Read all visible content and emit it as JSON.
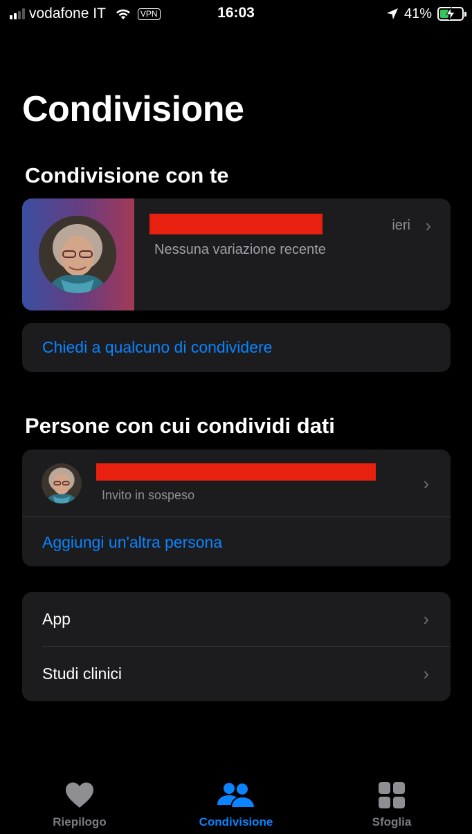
{
  "status_bar": {
    "carrier": "vodafone IT",
    "vpn": "VPN",
    "time": "16:03",
    "battery": "41%",
    "battery_level": 0.41
  },
  "page": {
    "title": "Condivisione"
  },
  "sharing_with_you": {
    "title": "Condivisione con te",
    "item": {
      "date": "ieri",
      "status": "Nessuna variazione recente"
    },
    "ask_link": "Chiedi a qualcuno di condividere"
  },
  "sharing_data": {
    "title": "Persone con cui condividi dati",
    "item": {
      "status": "Invito in sospeso"
    },
    "add_link": "Aggiungi un'altra persona"
  },
  "more": {
    "items": [
      {
        "label": "App"
      },
      {
        "label": "Studi clinici"
      }
    ]
  },
  "tab_bar": {
    "tabs": [
      {
        "label": "Riepilogo",
        "icon": "heart-icon"
      },
      {
        "label": "Condivisione",
        "icon": "people-icon"
      },
      {
        "label": "Sfoglia",
        "icon": "grid-icon"
      }
    ],
    "active_index": 1
  },
  "colors": {
    "accent": "#0a84ff",
    "card": "#1c1c1e",
    "redaction": "#e8200f"
  }
}
